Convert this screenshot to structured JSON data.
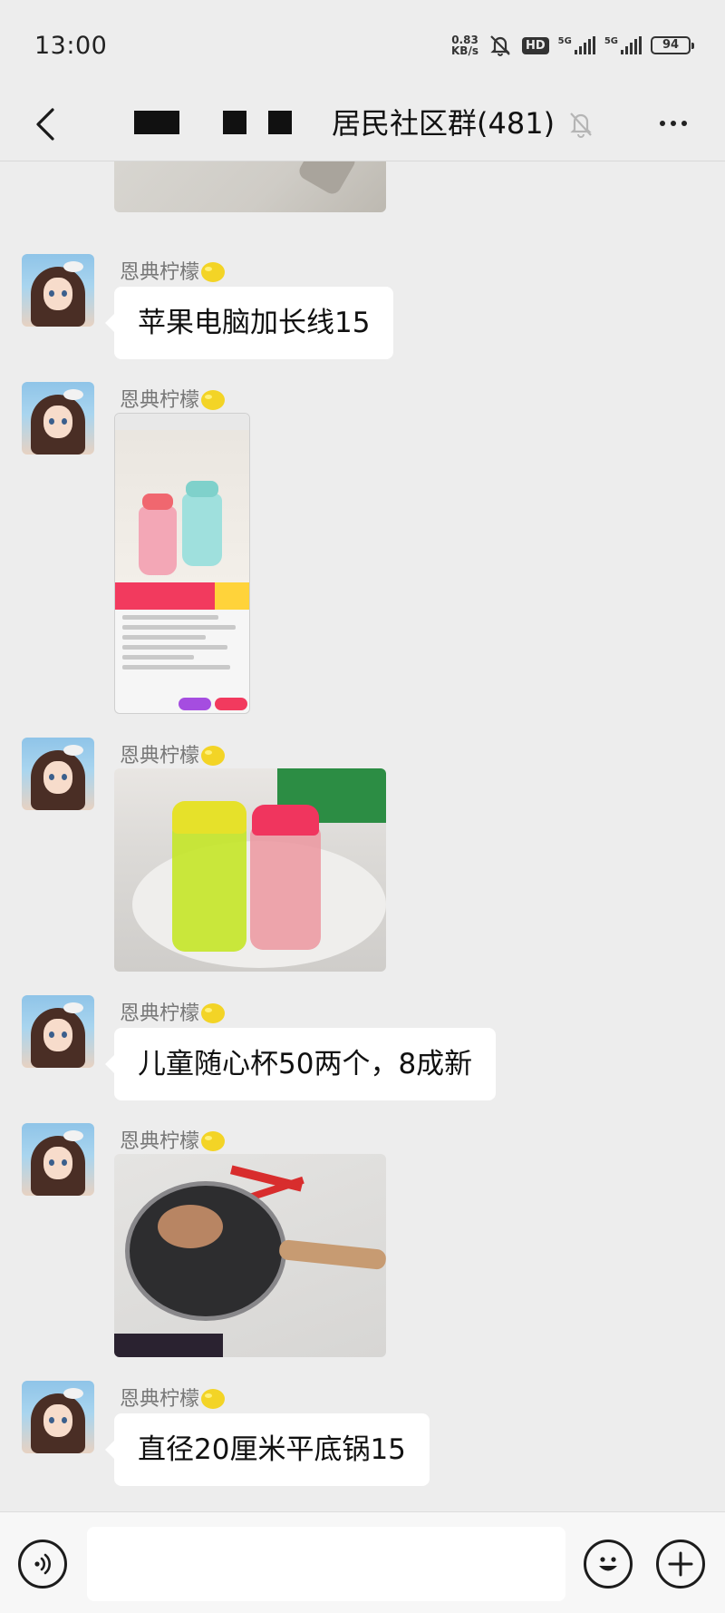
{
  "status_bar": {
    "time": "13:00",
    "net_speed_value": "0.83",
    "net_speed_unit": "KB/s",
    "hd_label": "HD",
    "signal1_label": "5G",
    "signal2_label": "5G",
    "battery": "94"
  },
  "nav": {
    "title": "居民社区群(481)"
  },
  "messages": [
    {
      "type": "image",
      "partial": true
    },
    {
      "type": "text",
      "sender": "恩典柠檬",
      "text": "苹果电脑加长线15"
    },
    {
      "type": "image",
      "sender": "恩典柠檬",
      "image": "product-screenshot"
    },
    {
      "type": "image",
      "sender": "恩典柠檬",
      "image": "water-bottles-photo"
    },
    {
      "type": "text",
      "sender": "恩典柠檬",
      "text": "儿童随心杯50两个，8成新"
    },
    {
      "type": "image",
      "sender": "恩典柠檬",
      "image": "frying-pan-photo"
    },
    {
      "type": "text",
      "sender": "恩典柠檬",
      "text": "直径20厘米平底锅15"
    }
  ],
  "input_bar": {
    "value": "",
    "placeholder": "",
    "icons": [
      "voice-icon",
      "emoji-icon",
      "plus-icon"
    ]
  }
}
